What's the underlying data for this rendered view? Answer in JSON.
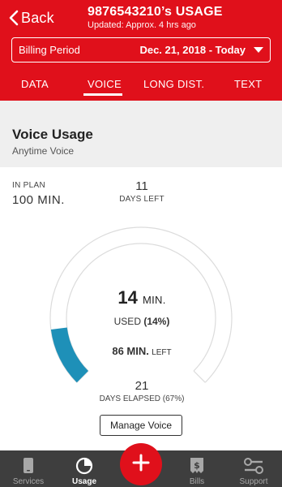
{
  "header": {
    "back_label": "Back",
    "title": "9876543210’s USAGE",
    "subtitle": "Updated: Approx. 4 hrs ago",
    "billing_label": "Billing Period",
    "billing_value": "Dec. 21, 2018 - Today"
  },
  "tabs": [
    {
      "label": "DATA",
      "active": false
    },
    {
      "label": "VOICE",
      "active": true
    },
    {
      "label": "LONG DIST.",
      "active": false
    },
    {
      "label": "TEXT",
      "active": false
    }
  ],
  "section": {
    "title": "Voice Usage",
    "subtitle": "Anytime Voice"
  },
  "usage": {
    "in_plan_label": "IN PLAN",
    "in_plan_value": "100 MIN.",
    "days_left_value": "11",
    "days_left_label": "DAYS LEFT",
    "used_value": "14",
    "used_unit": "MIN.",
    "used_label": "USED",
    "used_pct": "(14%)",
    "used_fraction": 0.14,
    "left_value": "86 MIN.",
    "left_label": "LEFT",
    "elapsed_value": "21",
    "elapsed_label": "DAYS ELAPSED (67%)",
    "manage_label": "Manage Voice"
  },
  "nav": {
    "items": [
      {
        "label": "Services",
        "icon": "phone-icon",
        "active": false
      },
      {
        "label": "Usage",
        "icon": "pie-chart-icon",
        "active": true
      },
      {
        "label": "Bills",
        "icon": "bill-icon",
        "active": false
      },
      {
        "label": "Support",
        "icon": "wrench-icon",
        "active": false
      }
    ],
    "fab_icon": "plus-icon"
  },
  "colors": {
    "brand": "#e0101b",
    "used_arc": "#1e90b8",
    "nav_bg": "#3e3e3e"
  }
}
